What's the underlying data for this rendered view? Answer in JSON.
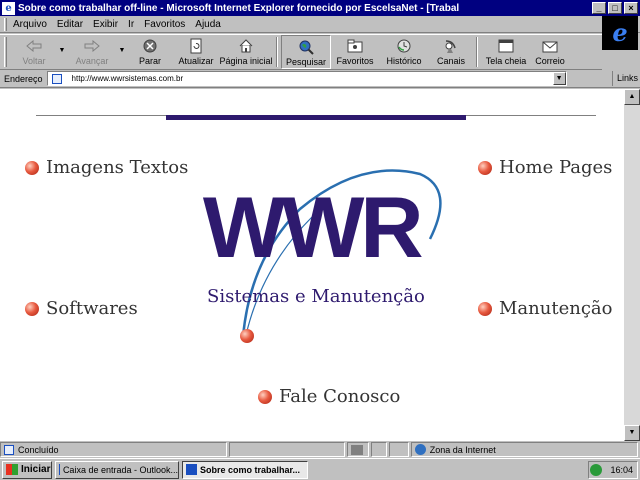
{
  "window": {
    "title": "Sobre como trabalhar off-line - Microsoft Internet Explorer fornecido por EscelsaNet - [Trabal",
    "controls": {
      "minimize": "_",
      "maximize": "□",
      "close": "×"
    }
  },
  "menu": {
    "items": [
      "Arquivo",
      "Editar",
      "Exibir",
      "Ir",
      "Favoritos",
      "Ajuda"
    ],
    "logo": "e"
  },
  "toolbar": {
    "back": "Voltar",
    "forward": "Avançar",
    "stop": "Parar",
    "refresh": "Atualizar",
    "home": "Página inicial",
    "search": "Pesquisar",
    "favorites": "Favoritos",
    "history": "Histórico",
    "channels": "Canais",
    "fullscreen": "Tela cheia",
    "mail": "Correio"
  },
  "address": {
    "label": "Endereço",
    "url": "http://www.wwrsistemas.com.br",
    "links": "Links"
  },
  "page": {
    "logo": "WWR",
    "subtitle": "Sistemas e Manutenção",
    "links": {
      "imagens": "Imagens Textos",
      "homepages": "Home Pages",
      "softwares": "Softwares",
      "manutencao": "Manutenção",
      "contato": "Fale Conosco"
    }
  },
  "status": {
    "text": "Concluído",
    "zone": "Zona da Internet"
  },
  "taskbar": {
    "start": "Iniciar",
    "tasks": [
      "Caixa de entrada - Outlook...",
      "Sobre como trabalhar..."
    ],
    "clock": "16:04"
  },
  "colors": {
    "title_bar": "#000080",
    "logo_purple": "#2e1a6e",
    "swoosh_blue": "#2a6fb0",
    "bullet_red": "#e85a40"
  }
}
